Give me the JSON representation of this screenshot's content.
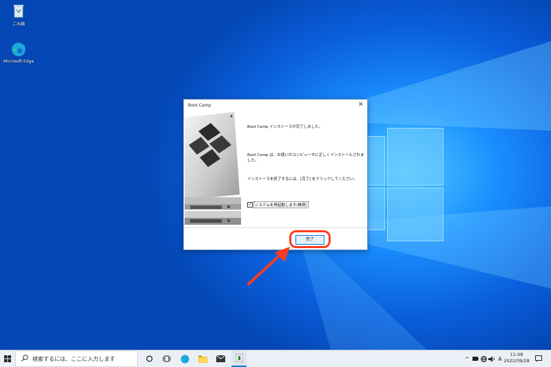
{
  "desktop": {
    "icons": [
      {
        "label": "ごみ箱",
        "icon": "recycle-bin-icon"
      },
      {
        "label": "Microsoft Edge",
        "icon": "edge-icon"
      }
    ]
  },
  "dialog": {
    "title": "Boot Camp",
    "message_complete": "Boot Camp インストーラが完了しました。",
    "message_installed_line1": "Boot Camp は、お使いのコンピュータに正しくインストールされま",
    "message_installed_line2": "した。",
    "message_finish_hint": "インストーラを終了するには、[完了] をクリックしてください。",
    "restart_checkbox_label": "システムを再起動します(推奨)",
    "restart_checked": true,
    "finish_button": "完了"
  },
  "taskbar": {
    "search_placeholder": "検索するには、ここに入力します",
    "ime_indicator": "A",
    "time": "11:08",
    "date": "2022/09/28"
  },
  "colors": {
    "highlight": "#ff3b1f",
    "accent": "#0078d7",
    "desktop_blue": "#0a5fdc"
  }
}
